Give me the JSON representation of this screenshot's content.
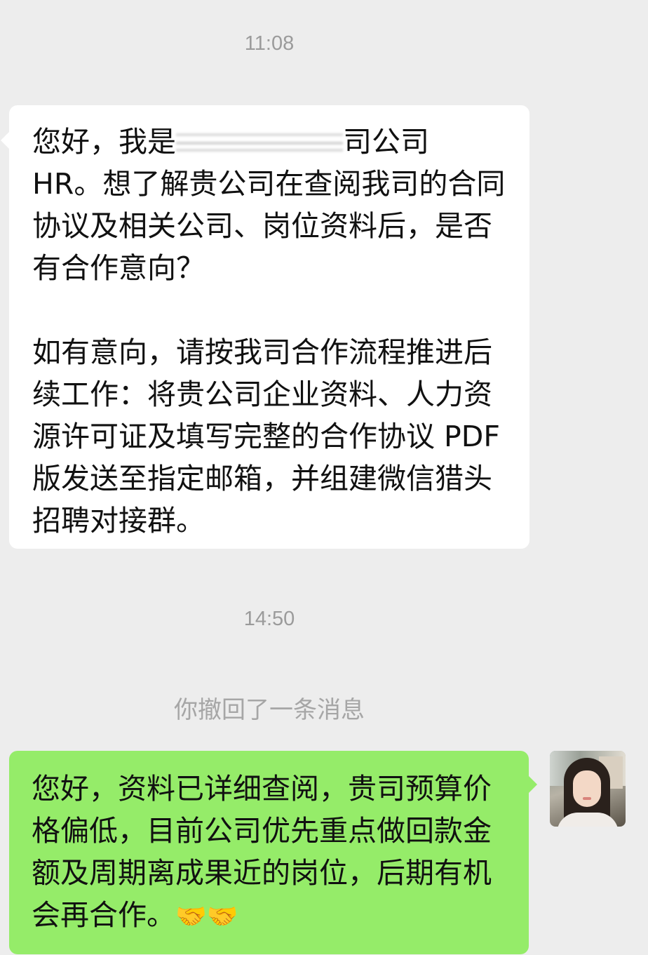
{
  "chat": {
    "timestamps": [
      "11:08",
      "14:50"
    ],
    "incoming": {
      "paragraph1_prefix": "您好，我是",
      "paragraph1_suffix": "司公司 HR。想了解贵公司在查阅我司的合同协议及相关公司、岗位资料后，是否有合作意向？",
      "paragraph2": "如有意向，请按我司合作流程推进后续工作：将贵公司企业资料、人力资源许可证及填写完整的合作协议 PDF 版发送至指定邮箱，并组建微信猎头招聘对接群。"
    },
    "recalled_notice": "你撤回了一条消息",
    "outgoing": {
      "text": "您好，资料已详细查阅，贵司预算价格偏低，目前公司优先重点做回款金额及周期离成果近的岗位，后期有机会再合作。",
      "emoji": [
        "🤝",
        "🤝"
      ]
    }
  },
  "icons": {
    "avatar": "user-avatar-photo",
    "emoji": "handshake-emoji"
  },
  "colors": {
    "background": "#ededed",
    "incoming_bubble": "#ffffff",
    "outgoing_bubble": "#95ec69",
    "timestamp_text": "#9b9b9b",
    "system_text": "#a6a6a6"
  }
}
